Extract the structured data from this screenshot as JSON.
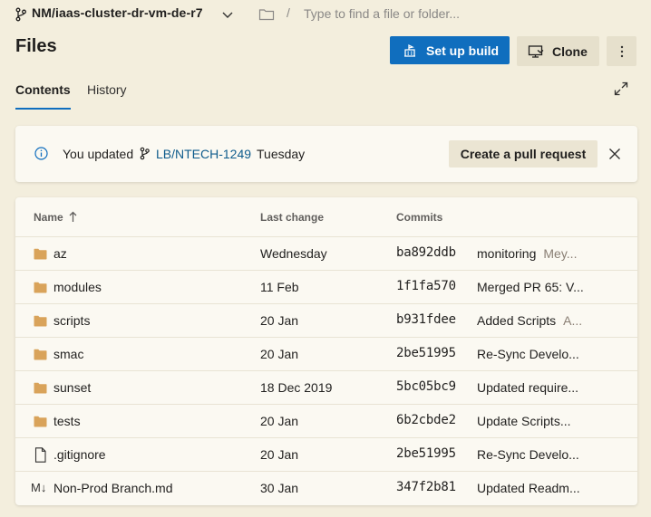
{
  "topbar": {
    "repo_name": "NM/iaas-cluster-dr-vm-de-r7",
    "path_separator": "/",
    "path_placeholder": "Type to find a file or folder..."
  },
  "header": {
    "title": "Files",
    "setup_build_label": "Set up build",
    "clone_label": "Clone"
  },
  "tabs": [
    {
      "label": "Contents",
      "active": true
    },
    {
      "label": "History",
      "active": false
    }
  ],
  "notice": {
    "prefix": "You updated",
    "branch": "LB/NTECH-1249",
    "when": "Tuesday",
    "pull_request_label": "Create a pull request"
  },
  "table": {
    "headers": {
      "name": "Name",
      "last_change": "Last change",
      "commits": "Commits"
    },
    "rows": [
      {
        "type": "folder",
        "name": "az",
        "last_change": "Wednesday",
        "commit": "ba892ddb",
        "message": "monitoring",
        "author": "Mey..."
      },
      {
        "type": "folder",
        "name": "modules",
        "last_change": "11 Feb",
        "commit": "1f1fa570",
        "message": "Merged PR 65: V...",
        "author": ""
      },
      {
        "type": "folder",
        "name": "scripts",
        "last_change": "20 Jan",
        "commit": "b931fdee",
        "message": "Added Scripts",
        "author": "A..."
      },
      {
        "type": "folder",
        "name": "smac",
        "last_change": "20 Jan",
        "commit": "2be51995",
        "message": "Re-Sync Develo...",
        "author": ""
      },
      {
        "type": "folder",
        "name": "sunset",
        "last_change": "18 Dec 2019",
        "commit": "5bc05bc9",
        "message": "Updated require...",
        "author": ""
      },
      {
        "type": "folder",
        "name": "tests",
        "last_change": "20 Jan",
        "commit": "6b2cbde2",
        "message": "Update Scripts...",
        "author": ""
      },
      {
        "type": "file",
        "name": ".gitignore",
        "last_change": "20 Jan",
        "commit": "2be51995",
        "message": "Re-Sync Develo...",
        "author": ""
      },
      {
        "type": "markdown",
        "name": "Non-Prod Branch.md",
        "last_change": "30 Jan",
        "commit": "347f2b81",
        "message": "Updated Readm...",
        "author": ""
      }
    ]
  },
  "colors": {
    "background": "#f3eedd",
    "primary_button": "#106ebe",
    "folder_icon": "#d9a35a",
    "link": "#0f5c8c"
  }
}
